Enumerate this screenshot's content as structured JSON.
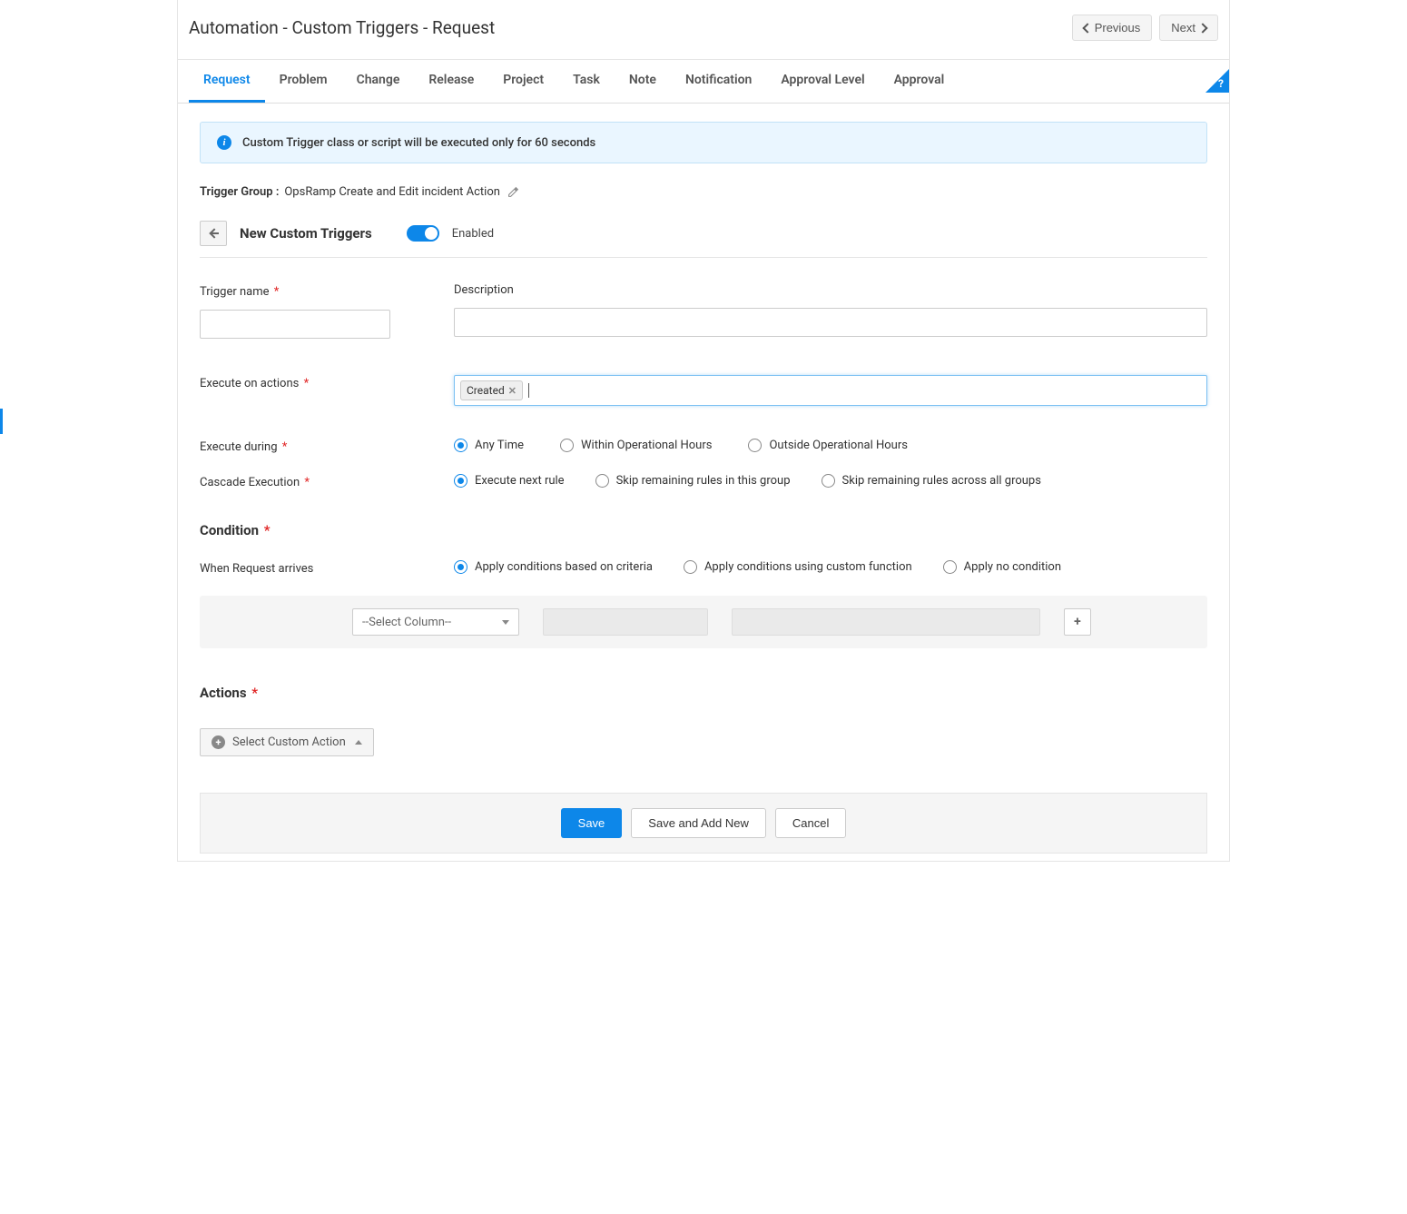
{
  "header": {
    "title": "Automation - Custom Triggers - Request",
    "previous": "Previous",
    "next": "Next"
  },
  "tabs": [
    "Request",
    "Problem",
    "Change",
    "Release",
    "Project",
    "Task",
    "Note",
    "Notification",
    "Approval Level",
    "Approval"
  ],
  "active_tab": "Request",
  "help_glyph": "?",
  "info_message": "Custom Trigger class or script will be executed only for 60 seconds",
  "trigger_group": {
    "label": "Trigger Group :",
    "value": "OpsRamp Create and Edit incident Action"
  },
  "section": {
    "title": "New Custom Triggers",
    "enabled_label": "Enabled"
  },
  "fields": {
    "trigger_name": "Trigger name",
    "description": "Description",
    "execute_on_actions": "Execute on actions",
    "execute_during": "Execute during",
    "cascade": "Cascade Execution",
    "tags": {
      "created": "Created"
    }
  },
  "execute_during_options": [
    "Any Time",
    "Within Operational Hours",
    "Outside Operational Hours"
  ],
  "cascade_options": [
    "Execute next rule",
    "Skip remaining rules in this group",
    "Skip remaining rules across all groups"
  ],
  "condition": {
    "heading": "Condition",
    "when_label": "When Request arrives",
    "options": [
      "Apply conditions based on criteria",
      "Apply conditions using custom function",
      "Apply no condition"
    ],
    "select_placeholder": "--Select Column--"
  },
  "actions": {
    "heading": "Actions",
    "select_custom": "Select Custom Action"
  },
  "footer": {
    "save": "Save",
    "save_add_new": "Save and Add New",
    "cancel": "Cancel"
  }
}
